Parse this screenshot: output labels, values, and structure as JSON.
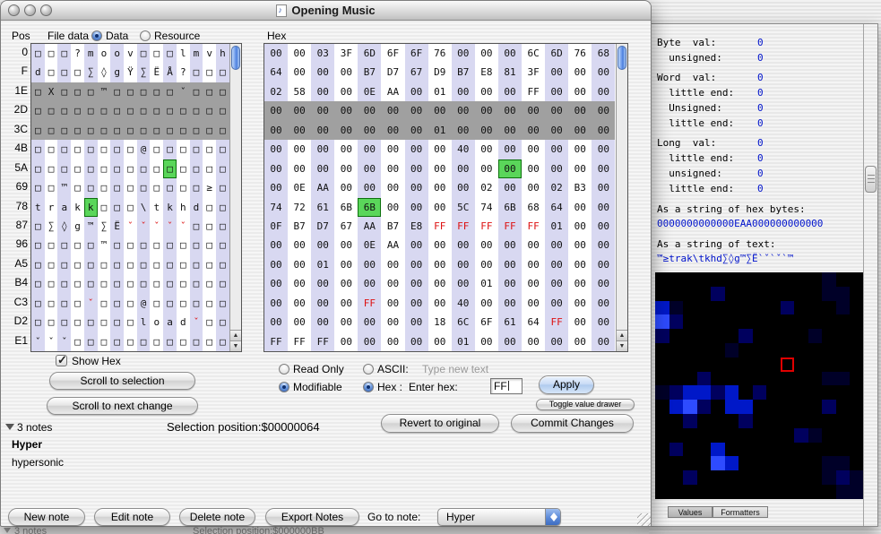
{
  "window": {
    "title": "Opening Music"
  },
  "header": {
    "pos_label": "Pos",
    "file_data_label": "File data",
    "radio_data": "Data",
    "radio_resource": "Resource",
    "hex_label": "Hex"
  },
  "editor": {
    "positions": [
      "0",
      "F",
      "1E",
      "2D",
      "3C",
      "4B",
      "5A",
      "69",
      "78",
      "87",
      "96",
      "A5",
      "B4",
      "C3",
      "D2",
      "E1"
    ],
    "ascii_rows": [
      [
        "□",
        "□",
        "□",
        "?",
        "m",
        "o",
        "o",
        "v",
        "□",
        "□",
        "□",
        "l",
        "m",
        "v",
        "h"
      ],
      [
        "d",
        "□",
        "□",
        "□",
        "∑",
        "◊",
        "g",
        "Ÿ",
        "∑",
        "Ë",
        "Å",
        "?",
        "□",
        "□",
        "□"
      ],
      [
        "□",
        "X",
        "□",
        "□",
        "□",
        "™",
        "□",
        "□",
        "□",
        "□",
        "□",
        "ˇ",
        "□",
        "□",
        "□"
      ],
      [
        "□",
        "□",
        "□",
        "□",
        "□",
        "□",
        "□",
        "□",
        "□",
        "□",
        "□",
        "□",
        "□",
        "□",
        "□"
      ],
      [
        "□",
        "□",
        "□",
        "□",
        "□",
        "□",
        "□",
        "□",
        "□",
        "□",
        "□",
        "□",
        "□",
        "□",
        "□"
      ],
      [
        "□",
        "□",
        "□",
        "□",
        "□",
        "□",
        "□",
        "□",
        "@",
        "□",
        "□",
        "□",
        "□",
        "□",
        "□"
      ],
      [
        "□",
        "□",
        "□",
        "□",
        "□",
        "□",
        "□",
        "□",
        "□",
        "□",
        "□",
        "□",
        "□",
        "□",
        "□"
      ],
      [
        "□",
        "□",
        "™",
        "□",
        "□",
        "□",
        "□",
        "□",
        "□",
        "□",
        "□",
        "□",
        "□",
        "≥",
        "□"
      ],
      [
        "t",
        "r",
        "a",
        "k",
        "k",
        "□",
        "□",
        "□",
        "\\",
        "t",
        "k",
        "h",
        "d",
        "□",
        "□"
      ],
      [
        "□",
        "∑",
        "◊",
        "g",
        "™",
        "∑",
        "Ë",
        "ˇ",
        "ˇ",
        "ˇ",
        "ˇ",
        "ˇ",
        "□",
        "□",
        "□"
      ],
      [
        "□",
        "□",
        "□",
        "□",
        "□",
        "™",
        "□",
        "□",
        "□",
        "□",
        "□",
        "□",
        "□",
        "□",
        "□"
      ],
      [
        "□",
        "□",
        "□",
        "□",
        "□",
        "□",
        "□",
        "□",
        "□",
        "□",
        "□",
        "□",
        "□",
        "□",
        "□"
      ],
      [
        "□",
        "□",
        "□",
        "□",
        "□",
        "□",
        "□",
        "□",
        "□",
        "□",
        "□",
        "□",
        "□",
        "□",
        "□"
      ],
      [
        "□",
        "□",
        "□",
        "□",
        "ˇ",
        "□",
        "□",
        "□",
        "@",
        "□",
        "□",
        "□",
        "□",
        "□",
        "□"
      ],
      [
        "□",
        "□",
        "□",
        "□",
        "□",
        "□",
        "□",
        "□",
        "l",
        "o",
        "a",
        "d",
        "ˇ",
        "□",
        "□"
      ],
      [
        "ˇ",
        "ˇ",
        "ˇ",
        "□",
        "□",
        "□",
        "□",
        "□",
        "□",
        "□",
        "□",
        "□",
        "□",
        "□",
        "□"
      ]
    ],
    "hex_rows": [
      [
        "00",
        "00",
        "03",
        "3F",
        "6D",
        "6F",
        "6F",
        "76",
        "00",
        "00",
        "00",
        "6C",
        "6D",
        "76",
        "68"
      ],
      [
        "64",
        "00",
        "00",
        "00",
        "B7",
        "D7",
        "67",
        "D9",
        "B7",
        "E8",
        "81",
        "3F",
        "00",
        "00",
        "00"
      ],
      [
        "02",
        "58",
        "00",
        "00",
        "0E",
        "AA",
        "00",
        "01",
        "00",
        "00",
        "00",
        "FF",
        "00",
        "00",
        "00"
      ],
      [
        "00",
        "00",
        "00",
        "00",
        "00",
        "00",
        "00",
        "00",
        "00",
        "00",
        "00",
        "00",
        "00",
        "00",
        "00"
      ],
      [
        "00",
        "00",
        "00",
        "00",
        "00",
        "00",
        "00",
        "01",
        "00",
        "00",
        "00",
        "00",
        "00",
        "00",
        "00"
      ],
      [
        "00",
        "00",
        "00",
        "00",
        "00",
        "00",
        "00",
        "00",
        "40",
        "00",
        "00",
        "00",
        "00",
        "00",
        "00"
      ],
      [
        "00",
        "00",
        "00",
        "00",
        "00",
        "00",
        "00",
        "00",
        "00",
        "00",
        "00",
        "00",
        "00",
        "00",
        "00"
      ],
      [
        "00",
        "0E",
        "AA",
        "00",
        "00",
        "00",
        "00",
        "00",
        "00",
        "02",
        "00",
        "00",
        "02",
        "B3",
        "00"
      ],
      [
        "74",
        "72",
        "61",
        "6B",
        "6B",
        "00",
        "00",
        "00",
        "5C",
        "74",
        "6B",
        "68",
        "64",
        "00",
        "00"
      ],
      [
        "0F",
        "B7",
        "D7",
        "67",
        "AA",
        "B7",
        "E8",
        "FF",
        "FF",
        "FF",
        "FF",
        "FF",
        "01",
        "00",
        "00"
      ],
      [
        "00",
        "00",
        "00",
        "00",
        "0E",
        "AA",
        "00",
        "00",
        "00",
        "00",
        "00",
        "00",
        "00",
        "00",
        "00"
      ],
      [
        "00",
        "00",
        "01",
        "00",
        "00",
        "00",
        "00",
        "00",
        "00",
        "00",
        "00",
        "00",
        "00",
        "00",
        "00"
      ],
      [
        "00",
        "00",
        "00",
        "00",
        "00",
        "00",
        "00",
        "00",
        "00",
        "01",
        "00",
        "00",
        "00",
        "00",
        "00"
      ],
      [
        "00",
        "00",
        "00",
        "00",
        "FF",
        "00",
        "00",
        "00",
        "40",
        "00",
        "00",
        "00",
        "00",
        "00",
        "00"
      ],
      [
        "00",
        "00",
        "00",
        "00",
        "00",
        "00",
        "00",
        "18",
        "6C",
        "6F",
        "61",
        "64",
        "FF",
        "00",
        "00"
      ],
      [
        "FF",
        "FF",
        "FF",
        "00",
        "00",
        "00",
        "00",
        "00",
        "01",
        "00",
        "00",
        "00",
        "00",
        "00",
        "00"
      ]
    ],
    "ascii_selected_rows": [
      2,
      3,
      4
    ],
    "hex_selected_rows": [
      3,
      4
    ],
    "green_cells": [
      [
        6,
        10
      ],
      [
        8,
        4
      ]
    ],
    "red_cells": [
      [
        9,
        7
      ],
      [
        9,
        8
      ],
      [
        9,
        9
      ],
      [
        9,
        10
      ],
      [
        9,
        11
      ],
      [
        13,
        4
      ],
      [
        14,
        12
      ]
    ]
  },
  "controls": {
    "show_hex": "Show Hex",
    "scroll_selection": "Scroll to selection",
    "scroll_next": "Scroll to next change",
    "read_only": "Read Only",
    "modifiable": "Modifiable",
    "ascii_label": "ASCII:",
    "hex_radio_label": "Hex :",
    "type_new_text": "Type new text",
    "enter_hex_label": "Enter hex:",
    "hex_value": "FF",
    "apply": "Apply",
    "toggle_drawer": "Toggle value drawer",
    "revert": "Revert to original",
    "commit": "Commit Changes",
    "selection_position": "Selection position:$00000064"
  },
  "notes": {
    "count_label": "3 notes",
    "note_title": "Hyper",
    "note_body": "hypersonic",
    "new_note": "New note",
    "edit_note": "Edit note",
    "delete_note": "Delete note",
    "export_notes": "Export Notes",
    "goto_label": "Go to note:",
    "goto_value": "Hyper"
  },
  "drawer": {
    "value_lines": [
      {
        "label": "Byte  val:",
        "value": "0",
        "group_start": true
      },
      {
        "label": "  unsigned:",
        "value": "0"
      },
      {
        "label": "Word  val:",
        "value": "0",
        "group_start": true
      },
      {
        "label": "  little end:",
        "value": "0"
      },
      {
        "label": "  Unsigned:",
        "value": "0"
      },
      {
        "label": "  little end:",
        "value": "0"
      },
      {
        "label": "Long  val:",
        "value": "0",
        "group_start": true
      },
      {
        "label": "  little end:",
        "value": "0"
      },
      {
        "label": "  unsigned:",
        "value": "0"
      },
      {
        "label": "  little end:",
        "value": "0"
      }
    ],
    "hex_string_label": "As a string of hex bytes:",
    "hex_string": "0000000000000EAA000000000000",
    "text_string_label": "As a string of text:",
    "text_string": "™≥trak\\tkhd∑◊g™∑Ë`ˇ`ˇ`™",
    "value_color": "#0013cc",
    "tabs": [
      "Values",
      "Formatters"
    ]
  },
  "viz": {
    "palette": [
      "#000000",
      "#000028",
      "#00005e",
      "#0018c8",
      "#2e4bff"
    ],
    "red_cell": [
      6,
      9
    ],
    "grid": [
      [
        0,
        0,
        0,
        0,
        0,
        0,
        0,
        0,
        0,
        0,
        0,
        0,
        1,
        0,
        0
      ],
      [
        0,
        0,
        0,
        0,
        2,
        0,
        0,
        0,
        0,
        0,
        0,
        0,
        1,
        1,
        0
      ],
      [
        3,
        1,
        0,
        0,
        0,
        0,
        0,
        0,
        0,
        2,
        0,
        0,
        0,
        1,
        0
      ],
      [
        4,
        2,
        0,
        0,
        0,
        0,
        0,
        0,
        0,
        0,
        0,
        0,
        0,
        0,
        0
      ],
      [
        2,
        0,
        0,
        0,
        0,
        0,
        2,
        0,
        0,
        0,
        0,
        1,
        0,
        0,
        0
      ],
      [
        0,
        0,
        0,
        0,
        0,
        1,
        0,
        0,
        0,
        0,
        0,
        0,
        0,
        0,
        0
      ],
      [
        0,
        0,
        0,
        0,
        0,
        0,
        0,
        0,
        0,
        0,
        0,
        0,
        0,
        0,
        0
      ],
      [
        0,
        0,
        0,
        2,
        0,
        0,
        0,
        0,
        0,
        0,
        0,
        0,
        1,
        1,
        0
      ],
      [
        1,
        2,
        3,
        3,
        2,
        3,
        0,
        2,
        0,
        0,
        0,
        0,
        0,
        0,
        0
      ],
      [
        0,
        3,
        4,
        2,
        0,
        3,
        3,
        0,
        0,
        0,
        0,
        0,
        2,
        0,
        0
      ],
      [
        0,
        0,
        2,
        0,
        0,
        0,
        2,
        0,
        0,
        0,
        0,
        0,
        0,
        0,
        0
      ],
      [
        0,
        0,
        0,
        0,
        0,
        0,
        0,
        0,
        0,
        0,
        2,
        1,
        0,
        0,
        0
      ],
      [
        0,
        2,
        0,
        0,
        3,
        0,
        0,
        0,
        0,
        0,
        0,
        0,
        0,
        0,
        0
      ],
      [
        0,
        0,
        0,
        0,
        4,
        3,
        0,
        0,
        0,
        0,
        0,
        0,
        1,
        1,
        0
      ],
      [
        0,
        0,
        2,
        0,
        0,
        0,
        0,
        0,
        0,
        0,
        0,
        0,
        1,
        2,
        1
      ],
      [
        0,
        0,
        0,
        0,
        0,
        0,
        0,
        0,
        0,
        0,
        0,
        0,
        0,
        1,
        1
      ]
    ]
  },
  "background_window": {
    "notes_label": "3 notes",
    "selection_label": "Selection position:$000000BB"
  }
}
